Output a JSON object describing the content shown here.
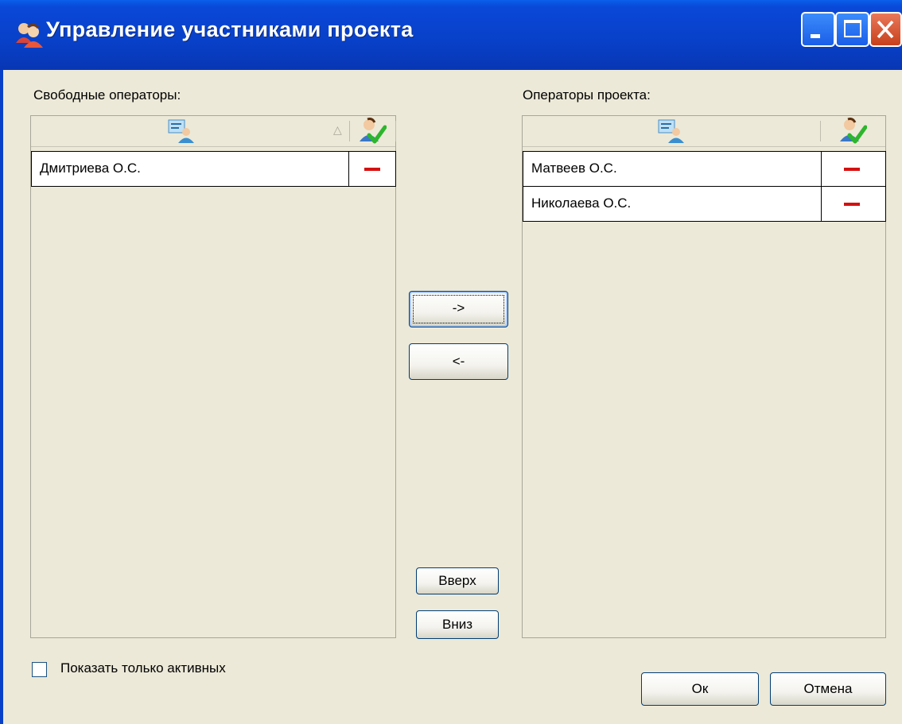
{
  "window": {
    "title": "Управление участниками проекта",
    "icons": {
      "app": "users-icon",
      "minimize": "minimize-icon",
      "maximize": "maximize-icon",
      "close": "close-icon"
    }
  },
  "left_panel": {
    "label": "Свободные операторы:",
    "sort_indicator": "△",
    "header_icons": [
      "operator-card-icon",
      "active-operator-icon"
    ],
    "rows": [
      {
        "name": "Дмитриева О.С.",
        "active_icon": "inactive-dash-icon"
      }
    ]
  },
  "right_panel": {
    "label": "Операторы проекта:",
    "header_icons": [
      "operator-card-icon",
      "active-operator-icon"
    ],
    "rows": [
      {
        "name": "Матвеев О.С.",
        "active_icon": "inactive-dash-icon"
      },
      {
        "name": "Николаева О.С.",
        "active_icon": "inactive-dash-icon"
      }
    ]
  },
  "transfer": {
    "add_label": "->",
    "remove_label": "<-"
  },
  "order": {
    "up_label": "Вверх",
    "down_label": "Вниз"
  },
  "filter": {
    "show_active_label": "Показать только активных",
    "checked": false
  },
  "footer": {
    "ok_label": "Ок",
    "cancel_label": "Отмена"
  },
  "colors": {
    "title_bar": "#0a48d8",
    "dialog_bg": "#ece9d8",
    "dash": "#d41010",
    "checkmark": "#2db52d"
  }
}
